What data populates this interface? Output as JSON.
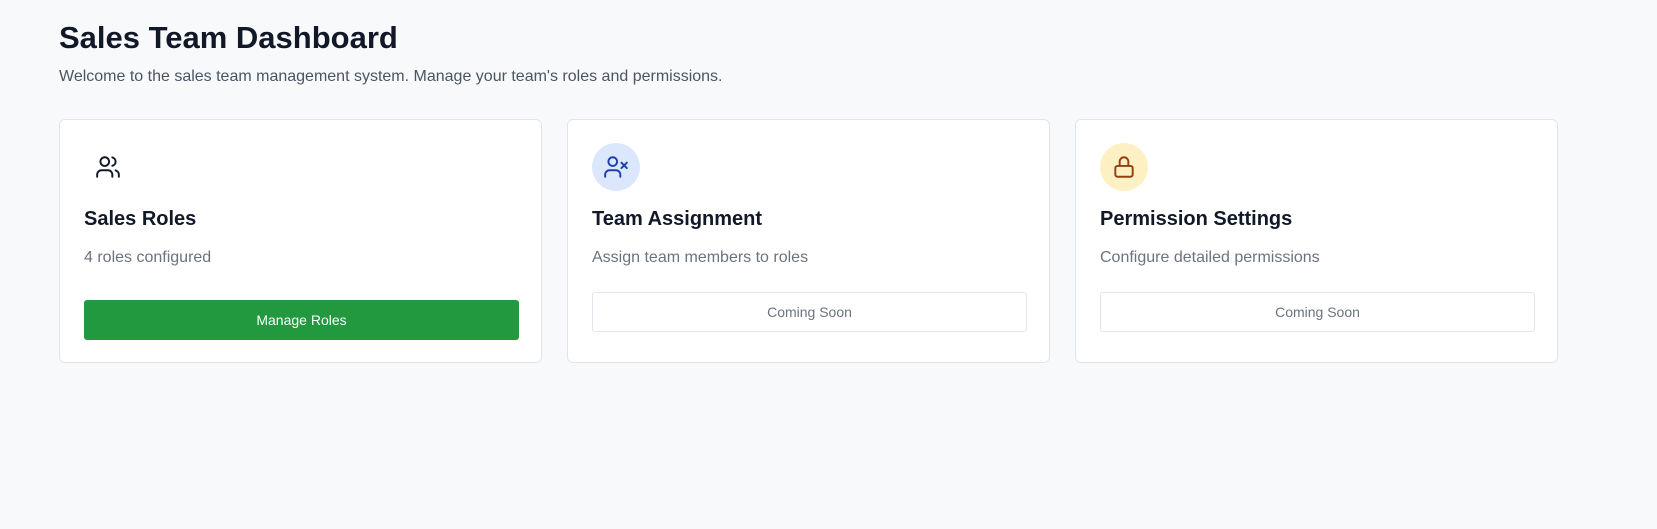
{
  "header": {
    "title": "Sales Team Dashboard",
    "subtitle": "Welcome to the sales team management system. Manage your team's roles and permissions."
  },
  "cards": [
    {
      "icon": "users-icon",
      "icon_color": "#111827",
      "icon_bg": "transparent",
      "title": "Sales Roles",
      "description": "4 roles configured",
      "button_label": "Manage Roles",
      "button_color": "#22993e"
    },
    {
      "icon": "user-x-icon",
      "icon_color": "#1e40af",
      "icon_bg": "#dbe7fd",
      "title": "Team Assignment",
      "description": "Assign team members to roles",
      "button_label": "Coming Soon"
    },
    {
      "icon": "lock-icon",
      "icon_color": "#92400e",
      "icon_bg": "#fdf1c4",
      "title": "Permission Settings",
      "description": "Configure detailed permissions",
      "button_label": "Coming Soon"
    }
  ]
}
